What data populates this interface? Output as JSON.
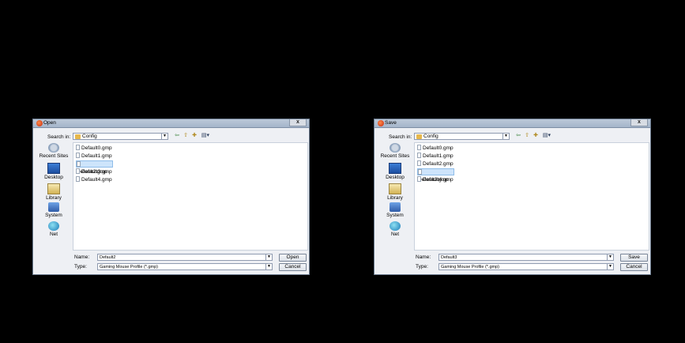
{
  "dialogs": [
    {
      "title": "Open",
      "search_in_label": "Search in:",
      "folder": "Config",
      "places": [
        {
          "label": "Recent Sites",
          "icon": "recent-sites-icon"
        },
        {
          "label": "Desktop",
          "icon": "desktop-icon"
        },
        {
          "label": "Library",
          "icon": "library-icon"
        },
        {
          "label": "System",
          "icon": "system-icon"
        },
        {
          "label": "Net",
          "icon": "net-icon"
        }
      ],
      "files": [
        "Default0.gmp",
        "Default1.gmp",
        "Default2.gmp",
        "Default3.gmp",
        "Default4.gmp"
      ],
      "selected_index": 2,
      "name_label": "Name:",
      "name_value": "Default2",
      "type_label": "Type:",
      "type_value": "Gaming  Mouse Profile (*.gmp)",
      "primary_button": "Open",
      "cancel_button": "Cancel",
      "close_glyph": "x"
    },
    {
      "title": "Save",
      "search_in_label": "Search in:",
      "folder": "Config",
      "places": [
        {
          "label": "Recent Sites",
          "icon": "recent-sites-icon"
        },
        {
          "label": "Desktop",
          "icon": "desktop-icon"
        },
        {
          "label": "Library",
          "icon": "library-icon"
        },
        {
          "label": "System",
          "icon": "system-icon"
        },
        {
          "label": "Net",
          "icon": "net-icon"
        }
      ],
      "files": [
        "Default0.gmp",
        "Default1.gmp",
        "Default2.gmp",
        "Default3.gmp",
        "Default4.gmp"
      ],
      "selected_index": 3,
      "name_label": "Name:",
      "name_value": "Default3",
      "type_label": "Type:",
      "type_value": "Gaming  Mouse Profile (*.gmp)",
      "primary_button": "Save",
      "cancel_button": "Cancel",
      "close_glyph": "x"
    }
  ],
  "colors": {
    "background": "#000000",
    "dialog_bg": "#eef0f4",
    "selection": "#cde4fb"
  }
}
